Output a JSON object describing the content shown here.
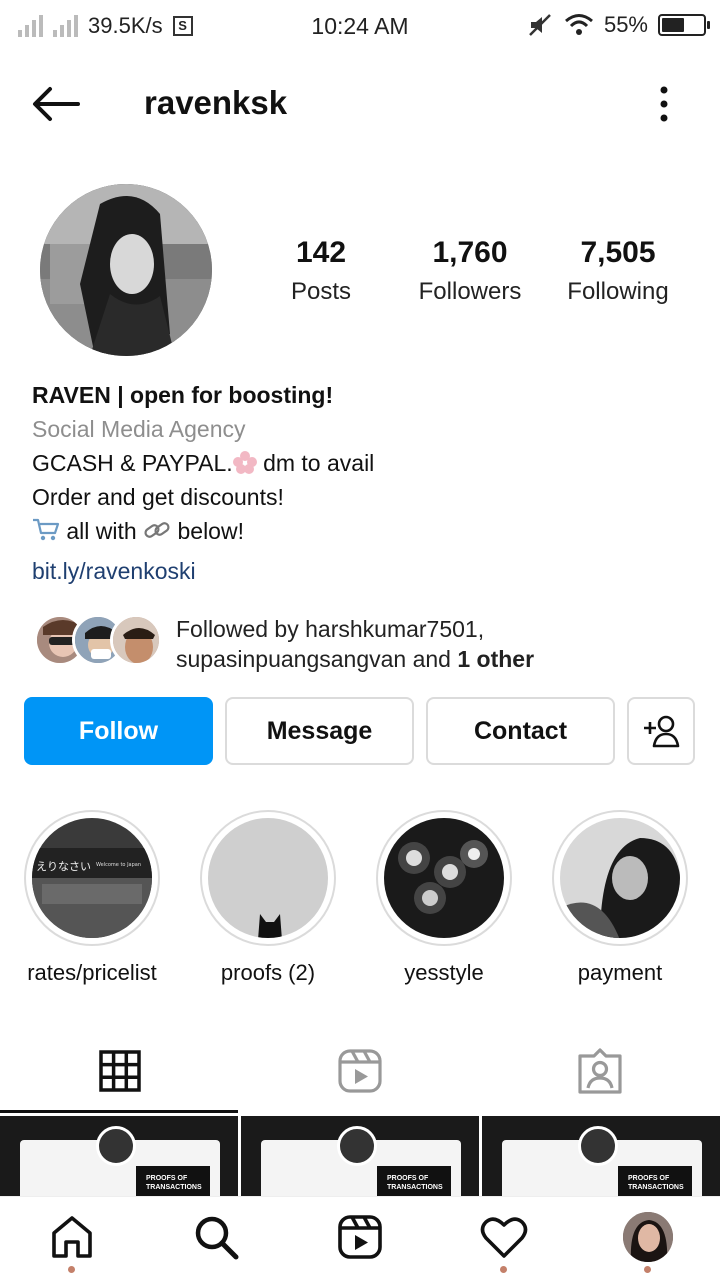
{
  "status_bar": {
    "net_speed": "39.5K/s",
    "s_icon": "S",
    "time": "10:24 AM",
    "battery": "55%",
    "battery_level": 0.55
  },
  "header": {
    "username": "ravenksk"
  },
  "stats": [
    {
      "value": "142",
      "label": "Posts"
    },
    {
      "value": "1,760",
      "label": "Followers"
    },
    {
      "value": "7,505",
      "label": "Following"
    }
  ],
  "bio": {
    "name": "RAVEN | open for boosting!",
    "category": "Social Media Agency",
    "line1_a": "GCASH & PAYPAL.",
    "line1_b": " dm to avail",
    "line2": "Order and get discounts!",
    "line3_a": " all with ",
    "line3_b": " below!",
    "link": "bit.ly/ravenkoski"
  },
  "followed_by": {
    "prefix": "Followed by harshkumar7501,",
    "line2": "supasinpuangsangvan and ",
    "bold": "1 other"
  },
  "buttons": {
    "follow": "Follow",
    "message": "Message",
    "contact": "Contact"
  },
  "highlights": [
    {
      "label": "rates/pricelist",
      "photo_text": "えりなさい",
      "photo_sign": "Welcome to Japan"
    },
    {
      "label": "proofs (2)"
    },
    {
      "label": "yesstyle"
    },
    {
      "label": "payment"
    }
  ],
  "grid": {
    "tag_text": "PROOFS OF TRANSACTIONS"
  },
  "colors": {
    "follow_blue": "#0095f6",
    "link_blue": "#1f3f70",
    "muted": "#8e8e8e",
    "nav_dot": "#c4806a"
  }
}
